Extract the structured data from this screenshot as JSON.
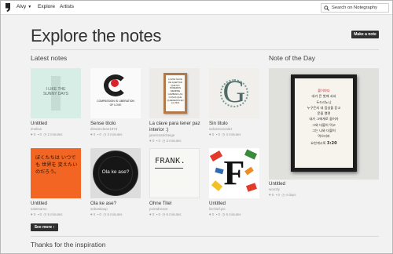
{
  "nav": {
    "user": "Alvy",
    "links": [
      "Explore",
      "Artists"
    ],
    "search_placeholder": "Search on Notegraphy"
  },
  "header": {
    "title": "Explore the notes",
    "make_note": "Make a note"
  },
  "latest": {
    "heading": "Latest notes",
    "see_more": "See more",
    "cards": [
      {
        "title": "Untitled",
        "user": "imelias",
        "likes": "0",
        "comments": "0",
        "time": "2 minutes",
        "thumb_text": "I LIKE THE SUNNY DAYS"
      },
      {
        "title": "Sense titolo",
        "user": "drewmclean1973",
        "likes": "0",
        "comments": "0",
        "time": "3 minutes",
        "thumb_text": "COMPASSION IS LIBERATION OF LOVE"
      },
      {
        "title": "La clave para tener paz interior :)",
        "user": "janetcasticbeige",
        "likes": "0",
        "comments": "0",
        "time": "3 minutes",
        "thumb_text": "LA PAZ NACE DE ACEPTAR QUE NO PODEMOS SIEMPRE CAMBIAR LAS COSAS QUE QUEREMOS EN LA VIDA"
      },
      {
        "title": "Sin titulo",
        "user": "salvaGonzalez",
        "likes": "0",
        "comments": "0",
        "time": "4 minutes",
        "thumb_text": "G"
      },
      {
        "title": "Untitled",
        "user": "sakesamo",
        "likes": "0",
        "comments": "0",
        "time": "5 minutes",
        "thumb_text": "ぼくたちは いつでも 世界を 変えたい のだろう。"
      },
      {
        "title": "Ola ke ase?",
        "user": "sebastiaup",
        "likes": "0",
        "comments": "0",
        "time": "6 minutes",
        "thumb_text": "Ola ke ase?"
      },
      {
        "title": "Ohne Titel",
        "user": "pointdreave",
        "likes": "0",
        "comments": "0",
        "time": "6 minutes",
        "thumb_text": "FRANK."
      },
      {
        "title": "Untitled",
        "user": "lizchief.pic",
        "likes": "0",
        "comments": "0",
        "time": "6 minutes",
        "thumb_text": "F"
      }
    ]
  },
  "notd": {
    "heading": "Note of the Day",
    "title": "Untitled",
    "user": "won2ly",
    "likes": "0",
    "comments": "0",
    "time": "4 days",
    "poster_lines": [
      "볼이야다",
      "내가 큰 벗에 서서",
      "두드리노니",
      "누구든지 내 음성을 듣고",
      "문을 열면",
      "내가 그에게로 들어가",
      "그와 더불어 먹고",
      "그는 나와 더불어",
      "먹으리라"
    ],
    "poster_ref_a": "요한계시록",
    "poster_ref_b": "3:20"
  },
  "footer": {
    "heading": "Thanks for the inspiration"
  },
  "colors": {
    "button": "#2f2f2f",
    "background": "#f2f2f2",
    "accent_orange": "#f26522"
  }
}
